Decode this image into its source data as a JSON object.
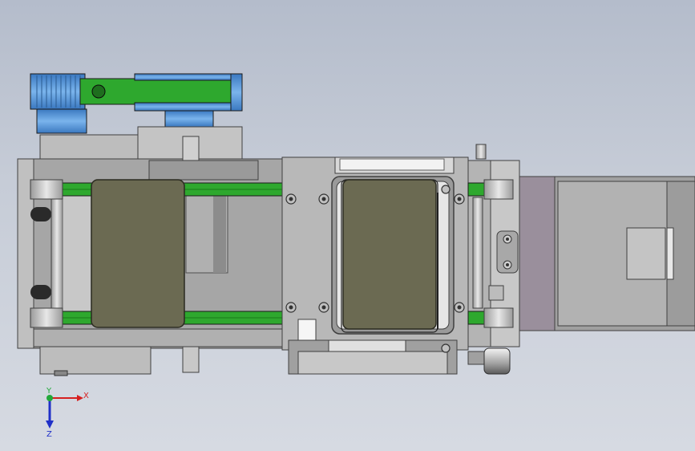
{
  "viewport": {
    "background_top": "#b4bccb",
    "background_bottom": "#d6dae2"
  },
  "colors": {
    "frame_gray": "#b8b8b8",
    "frame_dark": "#7e7e7e",
    "belt_green": "#2ea82e",
    "pad_olive": "#6b6a52",
    "pulley_blue": "#4a8ad0",
    "cover_mauve": "#9a8f9c"
  },
  "triad": {
    "x_label": "X",
    "y_label": "Y",
    "z_label": "Z",
    "x_color": "#d62020",
    "y_color": "#22a83a",
    "z_color": "#2030c8"
  }
}
